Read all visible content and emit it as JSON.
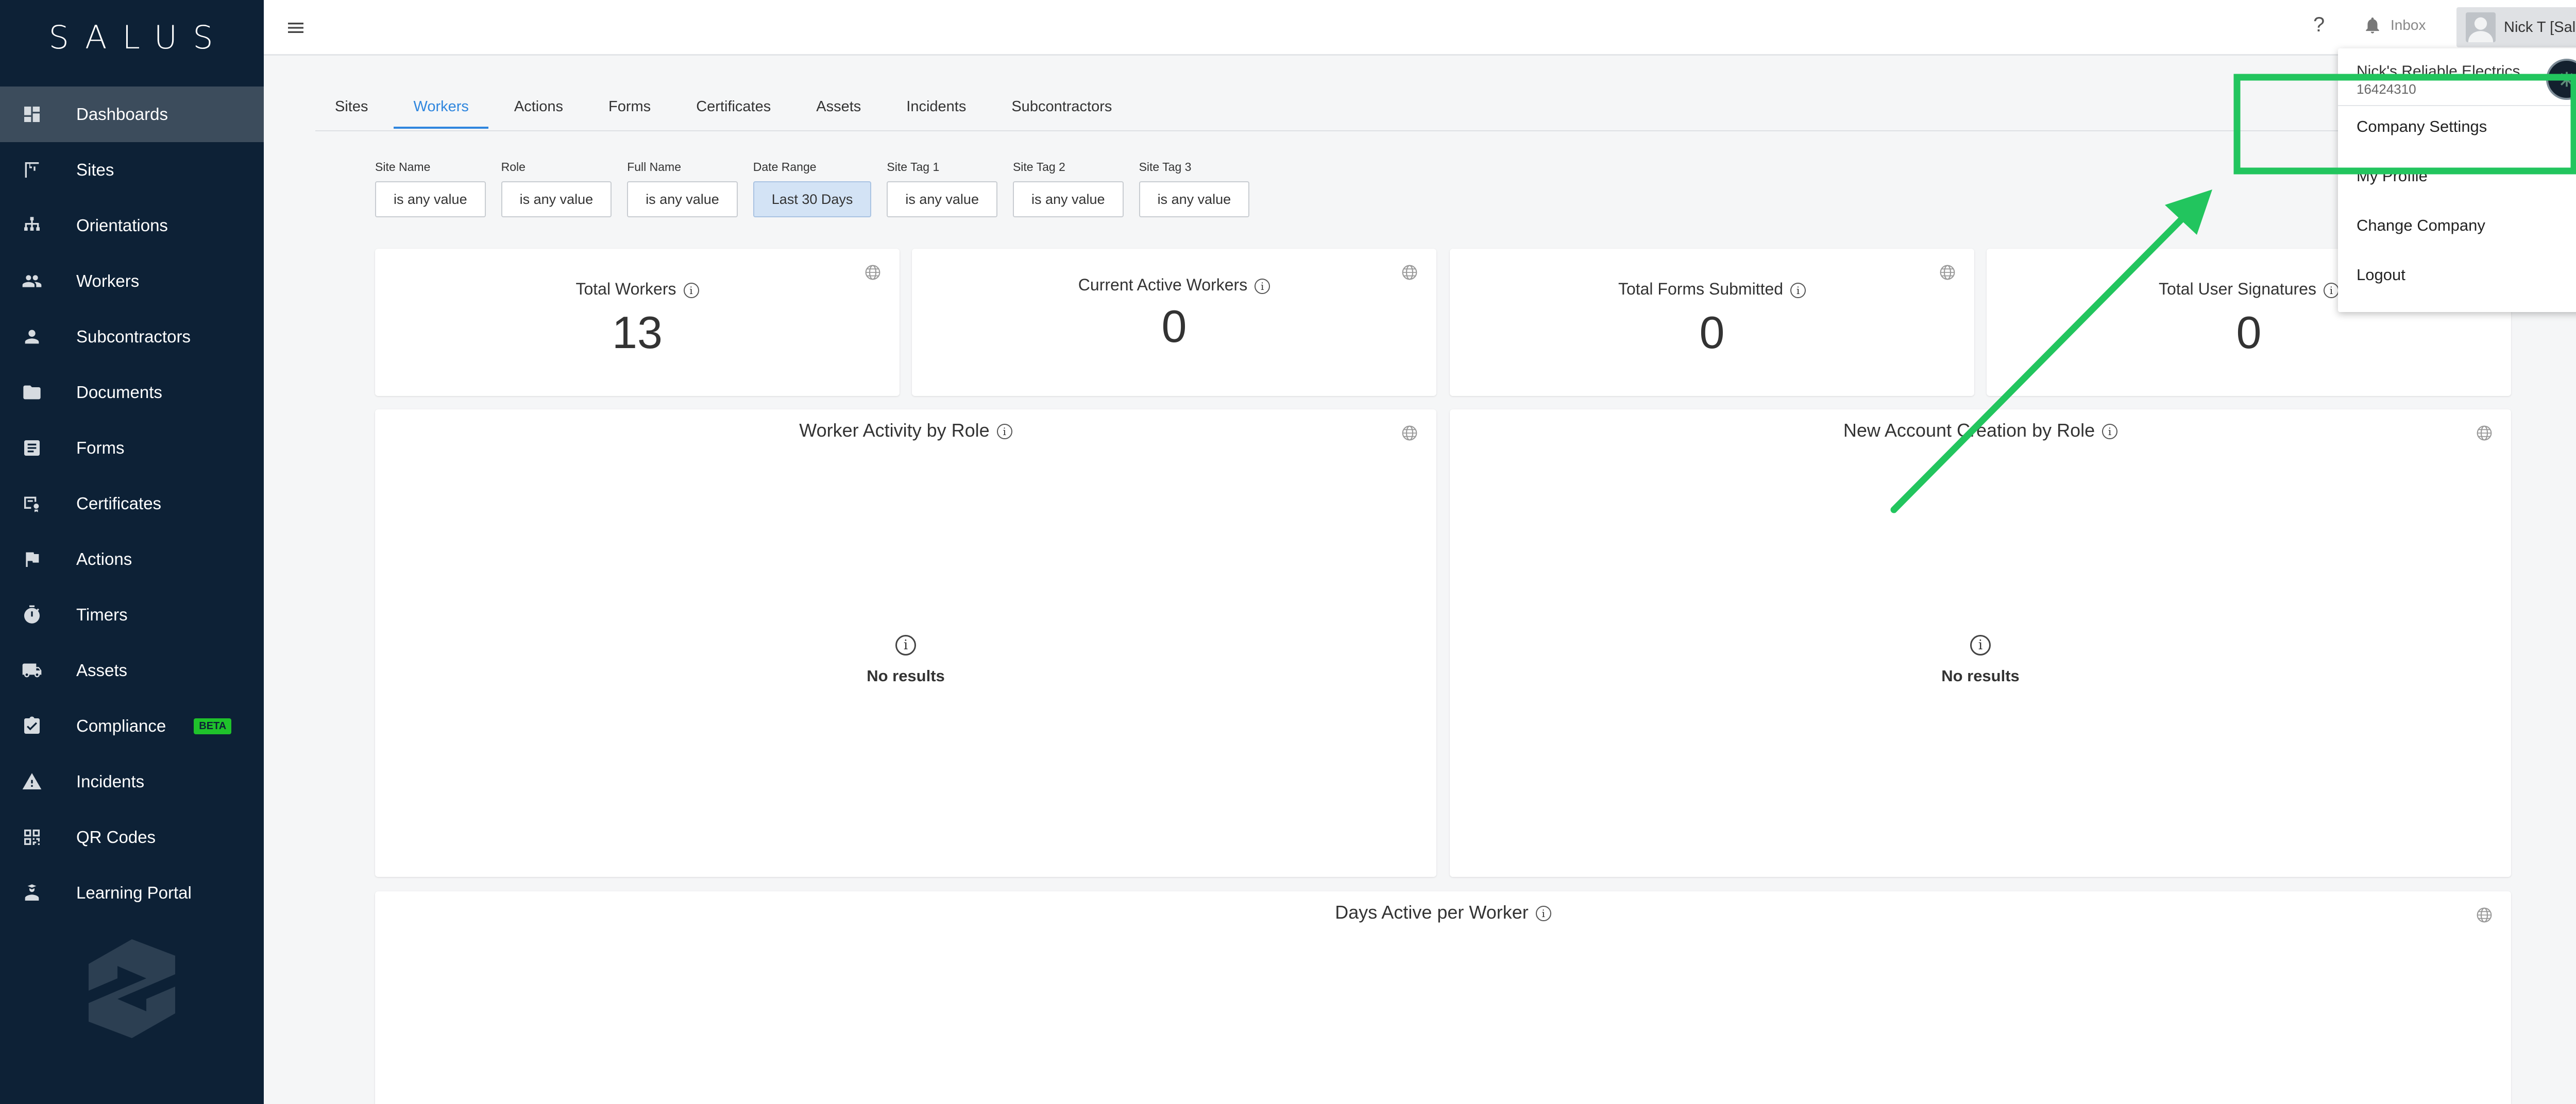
{
  "brand": {
    "name": "SALUS"
  },
  "sidebar": {
    "items": [
      {
        "label": "Dashboards",
        "icon": "dashboard-icon"
      },
      {
        "label": "Sites",
        "icon": "crane-icon"
      },
      {
        "label": "Orientations",
        "icon": "hierarchy-icon"
      },
      {
        "label": "Workers",
        "icon": "people-icon"
      },
      {
        "label": "Subcontractors",
        "icon": "person-icon"
      },
      {
        "label": "Documents",
        "icon": "folder-icon"
      },
      {
        "label": "Forms",
        "icon": "form-icon"
      },
      {
        "label": "Certificates",
        "icon": "certificate-icon"
      },
      {
        "label": "Actions",
        "icon": "flag-icon"
      },
      {
        "label": "Timers",
        "icon": "stopwatch-icon"
      },
      {
        "label": "Assets",
        "icon": "truck-icon"
      },
      {
        "label": "Compliance",
        "icon": "clipboard-check-icon",
        "badge": "BETA"
      },
      {
        "label": "Incidents",
        "icon": "warning-icon"
      },
      {
        "label": "QR Codes",
        "icon": "qr-code-icon"
      },
      {
        "label": "Learning Portal",
        "icon": "learner-icon"
      }
    ]
  },
  "header": {
    "help_label": "?",
    "inbox_label": "Inbox",
    "user_label": "Nick T [Salus]"
  },
  "tabs": [
    "Sites",
    "Workers",
    "Actions",
    "Forms",
    "Certificates",
    "Assets",
    "Incidents",
    "Subcontractors"
  ],
  "active_tab": "Workers",
  "filters": [
    {
      "label": "Site Name",
      "value": "is any value"
    },
    {
      "label": "Role",
      "value": "is any value"
    },
    {
      "label": "Full Name",
      "value": "is any value"
    },
    {
      "label": "Date Range",
      "value": "Last 30 Days"
    },
    {
      "label": "Site Tag 1",
      "value": "is any value"
    },
    {
      "label": "Site Tag 2",
      "value": "is any value"
    },
    {
      "label": "Site Tag 3",
      "value": "is any value"
    }
  ],
  "stats": [
    {
      "title": "Total Workers",
      "value": "13"
    },
    {
      "title": "Current Active Workers",
      "value": "0"
    },
    {
      "title": "Total Forms Submitted",
      "value": "0"
    },
    {
      "title": "Total User Signatures",
      "value": "0"
    }
  ],
  "charts": {
    "worker_activity": {
      "title": "Worker Activity by Role",
      "empty_text": "No results"
    },
    "new_accounts": {
      "title": "New Account Creation by Role",
      "empty_text": "No results"
    },
    "days_active": {
      "title": "Days Active per Worker"
    }
  },
  "dropdown": {
    "company_name": "Nick's Reliable Electrics",
    "company_id": "16424310",
    "items": [
      "Company Settings",
      "My Profile",
      "Change Company",
      "Logout"
    ]
  },
  "annotation": {
    "color": "#22c55e",
    "highlighted_item": "Company Settings"
  },
  "colors": {
    "sidebar_bg": "#0d2136",
    "accent": "#2f86de",
    "beta_badge": "#1fc22b"
  }
}
